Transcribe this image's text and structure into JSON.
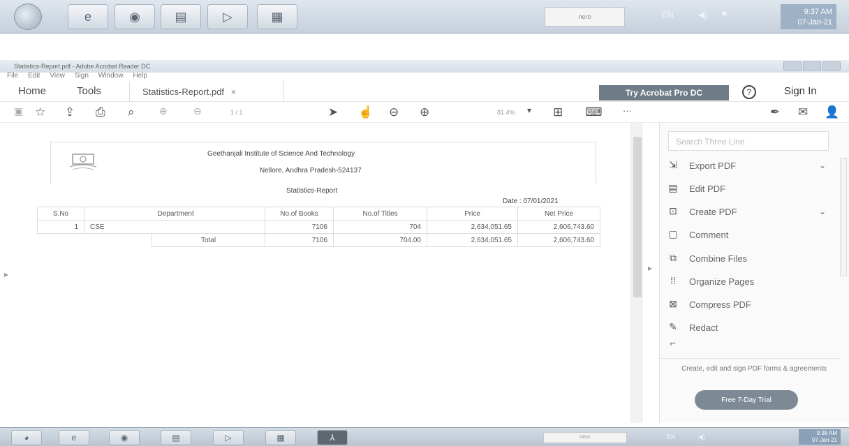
{
  "taskbar_top": {
    "tray": {
      "nero_label": "nero",
      "lang": "EN",
      "time": "9:37 AM",
      "date": "07-Jan-21"
    }
  },
  "window": {
    "title": "Statistics-Report.pdf - Adobe Acrobat Reader DC",
    "menu": [
      "File",
      "Edit",
      "View",
      "Sign",
      "Window",
      "Help"
    ]
  },
  "tabs": {
    "home": "Home",
    "tools": "Tools",
    "document": "Statistics-Report.pdf",
    "close_glyph": "×",
    "try_button": "Try Acrobat Pro DC",
    "help_glyph": "?",
    "sign_in": "Sign In"
  },
  "toolbar": {
    "page_indicator": "1 / 1",
    "zoom": "81.4%",
    "more": "···"
  },
  "document": {
    "institute": "Geethanjali Institute of Science And Technology",
    "location": "Nellore, Andhra Pradesh-524137",
    "report_title": "Statistics-Report",
    "date_label": "Date : 07/01/2021",
    "columns": [
      "S.No",
      "Department",
      "No.of Books",
      "No.of Titles",
      "Price",
      "Net Price"
    ],
    "rows": [
      [
        "1",
        "CSE",
        "7106",
        "704",
        "2,634,051.65",
        "2,606,743.60"
      ]
    ],
    "total": {
      "label": "Total",
      "books": "7106",
      "titles": "704.00",
      "price": "2,634,051.65",
      "net_price": "2,606,743.60"
    }
  },
  "right_panel": {
    "search_placeholder": "Search Three Line",
    "tools": [
      {
        "label": "Export PDF",
        "icon": "export-pdf-icon",
        "expandable": true
      },
      {
        "label": "Edit PDF",
        "icon": "edit-pdf-icon",
        "expandable": false
      },
      {
        "label": "Create PDF",
        "icon": "create-pdf-icon",
        "expandable": true
      },
      {
        "label": "Comment",
        "icon": "comment-icon",
        "expandable": false
      },
      {
        "label": "Combine Files",
        "icon": "combine-files-icon",
        "expandable": false
      },
      {
        "label": "Organize Pages",
        "icon": "organize-pages-icon",
        "expandable": false
      },
      {
        "label": "Compress PDF",
        "icon": "compress-pdf-icon",
        "expandable": false
      },
      {
        "label": "Redact",
        "icon": "redact-icon",
        "expandable": false
      }
    ],
    "promo_text": "Create, edit and sign PDF forms & agreements",
    "trial_button": "Free 7-Day Trial"
  },
  "taskbar_bottom": {
    "tray": {
      "nero_label": "nero",
      "lang": "EN",
      "time": "9:38 AM",
      "date": "07-Jan-21"
    }
  }
}
